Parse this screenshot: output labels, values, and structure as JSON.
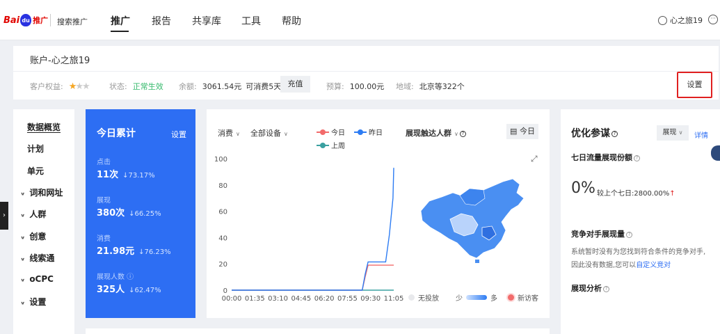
{
  "topnav": {
    "logo_text": "Bai",
    "logo_paw": "du",
    "logo_suffix": "推广",
    "product": "搜索推广",
    "items": [
      "推广",
      "报告",
      "共享库",
      "工具",
      "帮助"
    ],
    "user": "心之旅19"
  },
  "account": {
    "title": "账户-心之旅19",
    "rights_label": "客户权益:",
    "stars_active": 1,
    "stars_total": 3,
    "status_label": "状态:",
    "status_value": "正常生效",
    "balance_label": "余额:",
    "balance_value": "3061.54元",
    "consumable": "可消费5天",
    "recharge": "充值",
    "budget_label": "预算:",
    "budget_value": "100.00元",
    "region_label": "地域:",
    "region_value": "北京等322个",
    "settings": "设置"
  },
  "sidebar": {
    "items": [
      "数据概览",
      "计划",
      "单元"
    ],
    "groups": [
      "词和网址",
      "人群",
      "创意",
      "线索通",
      "oCPC",
      "设置"
    ]
  },
  "today_card": {
    "title": "今日累计",
    "settings": "设置",
    "metrics": [
      {
        "label": "点击",
        "value": "11次",
        "pct": "↓73.17%"
      },
      {
        "label": "展现",
        "value": "380次",
        "pct": "↓66.25%"
      },
      {
        "label": "消费",
        "value": "21.98元",
        "pct": "↓76.23%"
      },
      {
        "label": "展现人数 ⓘ",
        "value": "325人",
        "pct": "↓62.47%"
      }
    ]
  },
  "chart_card": {
    "metric_dropdown": "消费",
    "device_dropdown": "全部设备",
    "map_dropdown": "展现触达人群",
    "today_button": "今日",
    "map_legend": {
      "none": "无投放",
      "low": "少",
      "high": "多",
      "new": "新访客"
    }
  },
  "chart_data": {
    "type": "line",
    "x": [
      "00:00",
      "01:35",
      "03:10",
      "04:45",
      "06:20",
      "07:55",
      "09:30",
      "11:05"
    ],
    "ylim": [
      0,
      100
    ],
    "yticks": [
      0,
      20,
      40,
      60,
      80,
      100
    ],
    "series": [
      {
        "name": "今日",
        "color": "#f26b6b",
        "points": [
          [
            0,
            0
          ],
          [
            8.9,
            0
          ],
          [
            9.1,
            10
          ],
          [
            9.3,
            19
          ],
          [
            11.05,
            19
          ]
        ]
      },
      {
        "name": "昨日",
        "color": "#2d7cf3",
        "points": [
          [
            0,
            0
          ],
          [
            8.9,
            0
          ],
          [
            9.1,
            12
          ],
          [
            9.3,
            21.5
          ],
          [
            10.5,
            21.5
          ],
          [
            10.75,
            42
          ],
          [
            11.0,
            70
          ],
          [
            11.05,
            93
          ]
        ]
      },
      {
        "name": "上周",
        "color": "#3aa0a0",
        "points": [
          [
            0,
            0
          ],
          [
            11.05,
            0
          ]
        ]
      }
    ],
    "colors": {
      "today": "#f26b6b",
      "yesterday": "#2d7cf3",
      "lastweek": "#3aa0a0"
    }
  },
  "right_card": {
    "title": "优化参谋",
    "dropdown": "展现",
    "detail": "详情",
    "share_title": "七日流量展现份额",
    "share_value": "0%",
    "compare": "较上个七日:2800.00%",
    "compare_arrow": "↑",
    "competitor_title": "竞争对手展现量",
    "competitor_line1": "系统暂时没有为您找到符合条件的竞争对手,",
    "competitor_line2a": "因此没有数据,您可以",
    "competitor_link": "自定义竞对",
    "analysis_title": "展现分析"
  }
}
